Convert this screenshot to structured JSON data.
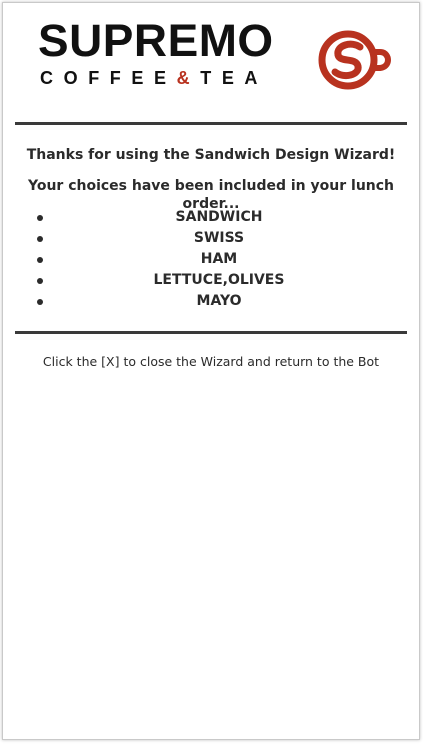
{
  "brand": {
    "name": "SUPREMO",
    "tagline_left": "COFFEE",
    "tagline_amp": "&",
    "tagline_right": "TEA",
    "logo_icon": "supremo-s-cup-logo",
    "colors": {
      "text": "#111111",
      "accent": "#b8321f"
    }
  },
  "confirmation": {
    "thanks": "Thanks for using the Sandwich Design Wizard!",
    "included": "Your choices have been included in your lunch order...",
    "items": [
      {
        "label": "SANDWICH"
      },
      {
        "label": "SWISS"
      },
      {
        "label": "HAM"
      },
      {
        "label": "LETTUCE,OLIVES"
      },
      {
        "label": "MAYO"
      }
    ],
    "close_note": "Click the [X] to close the Wizard and return to the Bot"
  }
}
